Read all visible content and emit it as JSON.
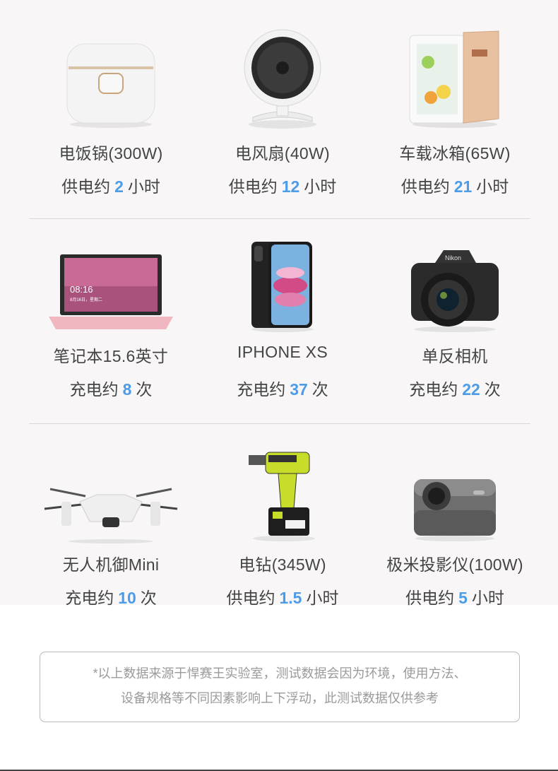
{
  "rows": [
    {
      "items": [
        {
          "name": "电饭锅(300W)",
          "prefix": "供电约",
          "value": "2",
          "unit": "小时",
          "icon": "rice-cooker"
        },
        {
          "name": "电风扇(40W)",
          "prefix": "供电约",
          "value": "12",
          "unit": "小时",
          "icon": "fan"
        },
        {
          "name": "车载冰箱(65W)",
          "prefix": "供电约",
          "value": "21",
          "unit": "小时",
          "icon": "car-fridge"
        }
      ]
    },
    {
      "items": [
        {
          "name": "笔记本15.6英寸",
          "prefix": "充电约",
          "value": "8",
          "unit": "次",
          "icon": "laptop",
          "screen_time": "08:16",
          "screen_date": "8月16日，星期二"
        },
        {
          "name": "IPHONE XS",
          "prefix": "充电约",
          "value": "37",
          "unit": "次",
          "icon": "phone"
        },
        {
          "name": "单反相机",
          "prefix": "充电约",
          "value": "22",
          "unit": "次",
          "icon": "camera",
          "brand": "Nikon"
        }
      ]
    },
    {
      "items": [
        {
          "name": "无人机御Mini",
          "prefix": "充电约",
          "value": "10",
          "unit": "次",
          "icon": "drone"
        },
        {
          "name": "电钻(345W)",
          "prefix": "供电约",
          "value": "1.5",
          "unit": "小时",
          "icon": "drill"
        },
        {
          "name": "极米投影仪(100W)",
          "prefix": "供电约",
          "value": "5",
          "unit": "小时",
          "icon": "projector"
        }
      ]
    }
  ],
  "note": {
    "line1": "*以上数据来源于悍赛王实验室，测试数据会因为环境，使用方法、",
    "line2": "设备规格等不同因素影响上下浮动，此测试数据仅供参考"
  },
  "colors": {
    "accent": "#4d9ce8",
    "text": "#444444",
    "panel": "#f8f6f7"
  }
}
